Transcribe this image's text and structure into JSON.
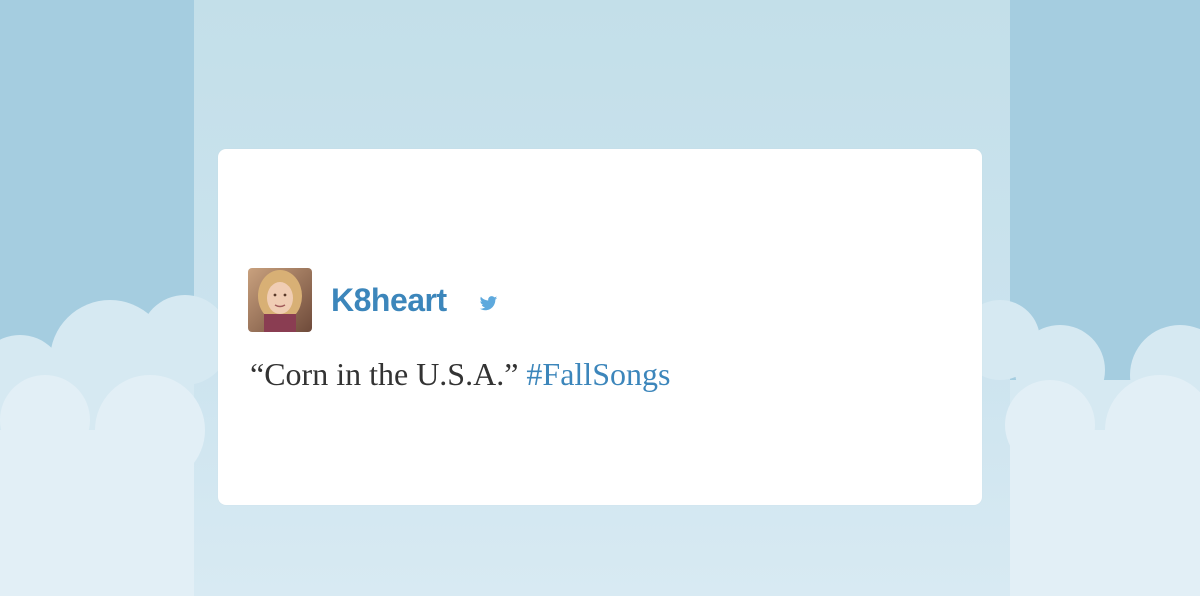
{
  "colors": {
    "sky": "#a5cde0",
    "center_column": "#c3dfe9",
    "card": "#ffffff",
    "link": "#3c86bb",
    "text": "#333333",
    "bird": "#5ea9dd"
  },
  "tweet": {
    "username": "K8heart",
    "avatar_icon": "user-avatar-photo",
    "platform_icon": "twitter-bird-icon",
    "text": "“Corn in the U.S.A.”",
    "hashtag": "#FallSongs"
  }
}
